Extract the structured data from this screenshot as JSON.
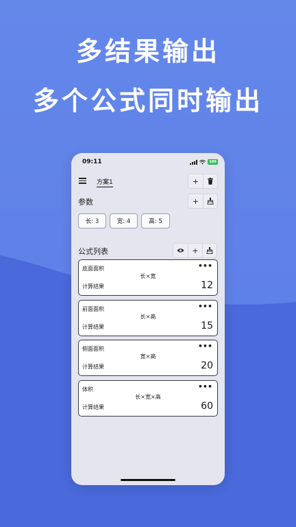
{
  "headline": {
    "line1": "多结果输出",
    "line2": "多个公式同时输出"
  },
  "colors": {
    "background": "#5b7be6",
    "phone_bg": "#e4e5ee",
    "battery": "#3ac45d"
  },
  "status_bar": {
    "time": "09:11",
    "battery_level": "100"
  },
  "topbar": {
    "tab": "方案1",
    "add_label": "+",
    "delete_icon": "trash-icon"
  },
  "params": {
    "title": "参数",
    "add_label": "+",
    "clear_icon": "broom-icon",
    "items": [
      {
        "label": "长: 3"
      },
      {
        "label": "宽: 4"
      },
      {
        "label": "高: 5"
      }
    ]
  },
  "formulas": {
    "title": "公式列表",
    "view_icon": "eye-icon",
    "add_label": "+",
    "clear_icon": "broom-icon",
    "more_label": "•••",
    "items": [
      {
        "name": "底面面积",
        "formula": "长×宽",
        "result_label": "计算结果",
        "result": "12"
      },
      {
        "name": "前面面积",
        "formula": "长×高",
        "result_label": "计算结果",
        "result": "15"
      },
      {
        "name": "侧面面积",
        "formula": "宽×高",
        "result_label": "计算结果",
        "result": "20"
      },
      {
        "name": "体积",
        "formula": "长×宽×高",
        "result_label": "计算结果",
        "result": "60"
      }
    ]
  }
}
